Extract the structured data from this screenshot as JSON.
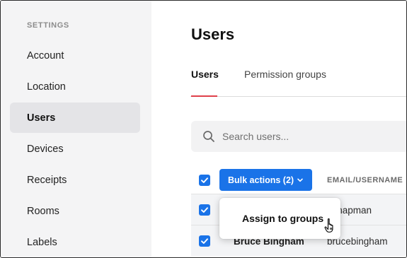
{
  "sidebar": {
    "heading": "SETTINGS",
    "items": [
      {
        "label": "Account",
        "active": false
      },
      {
        "label": "Location",
        "active": false
      },
      {
        "label": "Users",
        "active": true
      },
      {
        "label": "Devices",
        "active": false
      },
      {
        "label": "Receipts",
        "active": false
      },
      {
        "label": "Rooms",
        "active": false
      },
      {
        "label": "Labels",
        "active": false
      }
    ]
  },
  "main": {
    "title": "Users",
    "tabs": [
      {
        "label": "Users",
        "active": true
      },
      {
        "label": "Permission groups",
        "active": false
      }
    ],
    "search": {
      "placeholder": "Search users...",
      "value": "",
      "icon": "search-icon"
    },
    "toolbar": {
      "bulk_actions_label": "Bulk actions (2)",
      "select_all_checked": true
    },
    "table": {
      "columns": [
        "EMAIL/USERNAME"
      ],
      "rows": [
        {
          "name": "",
          "email": "achapman",
          "checked": true
        },
        {
          "name": "Bruce Bingham",
          "email": "brucebingham",
          "checked": true
        }
      ]
    },
    "bulk_menu": {
      "items": [
        "Assign to groups"
      ]
    }
  },
  "colors": {
    "accent": "#1a73e8",
    "tab_underline": "#e0404a",
    "sidebar_bg": "#f4f4f5",
    "sidebar_active_bg": "#e4e4e7"
  }
}
